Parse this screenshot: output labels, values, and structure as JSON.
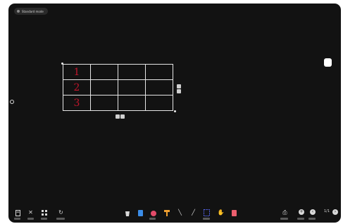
{
  "window": {
    "title": "Standard mode"
  },
  "table": {
    "rows": [
      [
        "1",
        "",
        "",
        ""
      ],
      [
        "2",
        "",
        "",
        ""
      ],
      [
        "3",
        "",
        "",
        ""
      ]
    ]
  },
  "toolbar": {
    "left_icons": [
      "file-icon",
      "tools-icon",
      "grid-icon",
      "refresh-icon"
    ],
    "center_icons": [
      "bucket-icon",
      "cup-icon",
      "paint-icon",
      "hammer-icon",
      "brush-icon",
      "pen-icon",
      "select-icon",
      "hand-icon",
      "eraser-icon"
    ],
    "right_icons": [
      "save-icon",
      "add-page-icon",
      "prev-page-icon",
      "next-page-icon"
    ],
    "page_indicator": "1/1"
  },
  "colors": {
    "canvas": "#121212",
    "handwriting": "#c0152b",
    "table_lines": "#e6e6e6"
  }
}
